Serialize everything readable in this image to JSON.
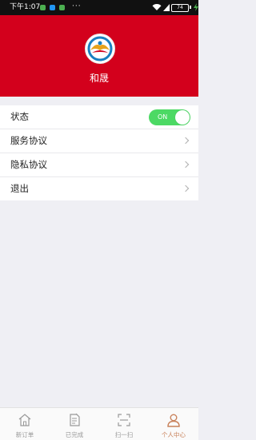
{
  "status_bar": {
    "time": "下午1:07",
    "more": "···",
    "battery": "74",
    "app_icon_colors": [
      "#4caf50",
      "#2196f3",
      "#4caf50"
    ]
  },
  "profile": {
    "name": "和晟",
    "avatar": "company-logo-icon",
    "header_color": "#d3001c"
  },
  "settings": {
    "items": [
      {
        "label": "状态",
        "type": "toggle",
        "value": "ON"
      },
      {
        "label": "服务协议",
        "type": "link"
      },
      {
        "label": "隐私协议",
        "type": "link"
      },
      {
        "label": "退出",
        "type": "link"
      }
    ]
  },
  "tabbar": {
    "items": [
      {
        "label": "新订单",
        "icon": "home-icon",
        "active": false
      },
      {
        "label": "已完成",
        "icon": "document-icon",
        "active": false
      },
      {
        "label": "扫一扫",
        "icon": "scan-icon",
        "active": false
      },
      {
        "label": "个人中心",
        "icon": "person-icon",
        "active": true
      }
    ],
    "active_color": "#c8815a",
    "inactive_color": "#999999"
  },
  "colors": {
    "toggle_on": "#4cd964",
    "background": "#efeff4"
  }
}
